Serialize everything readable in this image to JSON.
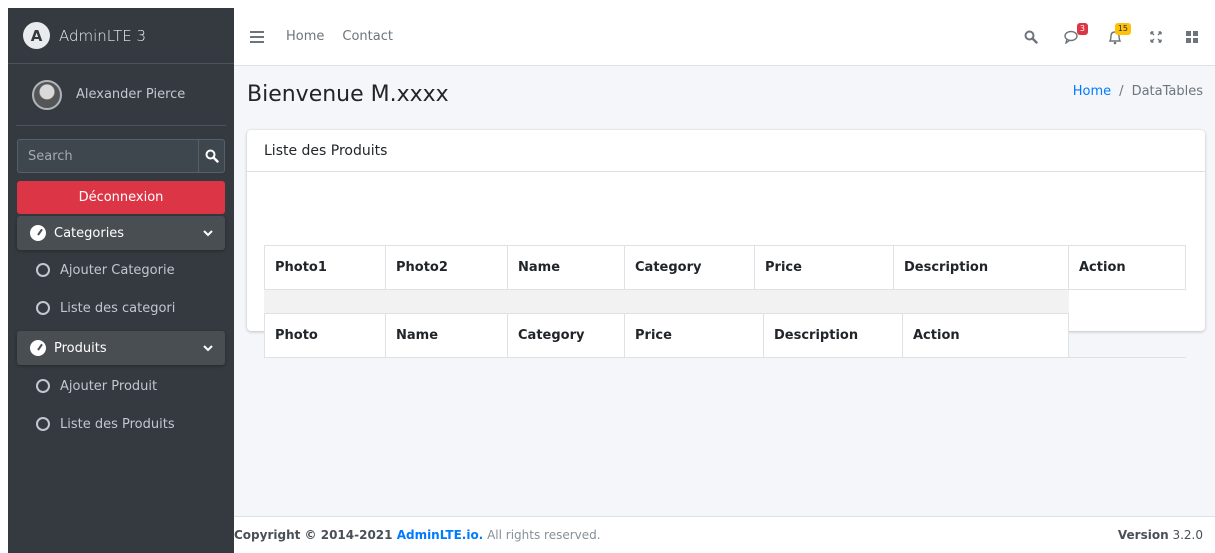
{
  "sidebar": {
    "brand": "AdminLTE 3",
    "brand_initial": "A",
    "user_name": "Alexander Pierce",
    "search_placeholder": "Search",
    "logout_label": "Déconnexion",
    "groups": [
      {
        "label": "Categories",
        "items": [
          "Ajouter Categorie",
          "Liste des categori"
        ]
      },
      {
        "label": "Produits",
        "items": [
          "Ajouter Produit",
          "Liste des Produits"
        ]
      }
    ]
  },
  "navbar": {
    "links": [
      "Home",
      "Contact"
    ],
    "messages_badge": "3",
    "notifications_badge": "15"
  },
  "content": {
    "title": "Bienvenue M.xxxx",
    "breadcrumb": {
      "home": "Home",
      "separator": "/",
      "active": "DataTables"
    },
    "card_title": "Liste des Produits",
    "table_header": [
      "Photo1",
      "Photo2",
      "Name",
      "Category",
      "Price",
      "Description",
      "Action"
    ],
    "table_footer": [
      "Photo",
      "Name",
      "Category",
      "Price",
      "Description",
      "Action"
    ]
  },
  "footer": {
    "copyright": "Copyright © 2014-2021 ",
    "link": "AdminLTE.io.",
    "rights": " All rights reserved.",
    "version_label": "Version",
    "version_value": " 3.2.0"
  },
  "colors": {
    "sidebar_bg": "#343a40",
    "danger": "#dc3545",
    "primary": "#007bff",
    "warning": "#ffc107"
  }
}
